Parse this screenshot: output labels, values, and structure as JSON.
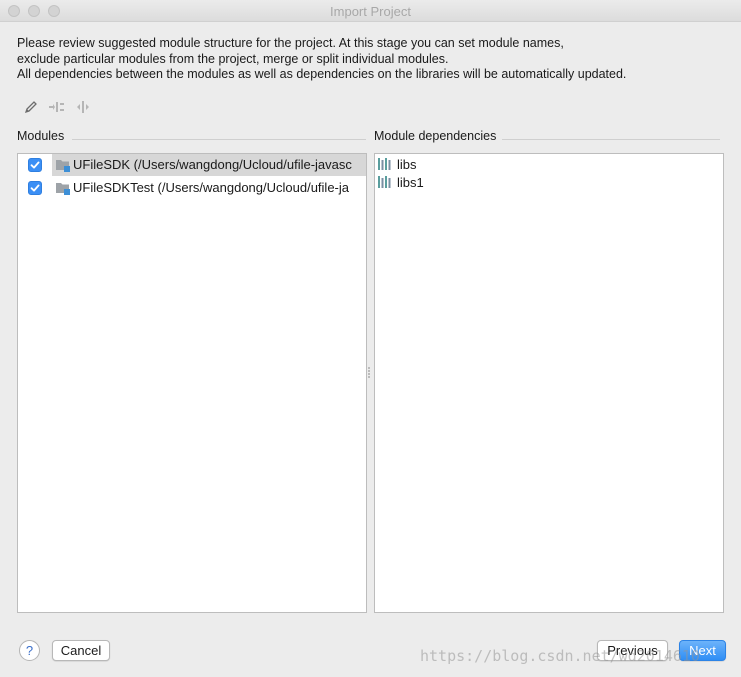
{
  "window": {
    "title": "Import Project"
  },
  "description": {
    "line1": "Please review suggested module structure for the project. At this stage you can set module names,",
    "line2": "exclude particular modules from the project, merge or split individual modules.",
    "line3": "All dependencies between the modules as well as dependencies on the libraries will be automatically updated."
  },
  "toolbar": {
    "icons": [
      "pencil-icon",
      "merge-icon",
      "split-icon"
    ]
  },
  "modules": {
    "label": "Modules",
    "items": [
      {
        "name": "UFileSDK (/Users/wangdong/Ucloud/ufile-javasc",
        "checked": true,
        "selected": true
      },
      {
        "name": "UFileSDKTest (/Users/wangdong/Ucloud/ufile-ja",
        "checked": true,
        "selected": false
      }
    ]
  },
  "dependencies": {
    "label": "Module dependencies",
    "items": [
      {
        "name": "libs"
      },
      {
        "name": "libs1"
      }
    ]
  },
  "buttons": {
    "help": "?",
    "cancel": "Cancel",
    "previous": "Previous",
    "next": "Next"
  },
  "watermark": "https://blog.csdn.net/wd2014610",
  "colors": {
    "accent": "#3b8ff5",
    "selection": "#d7d7d7",
    "library_icon": "#5a9e9e"
  }
}
